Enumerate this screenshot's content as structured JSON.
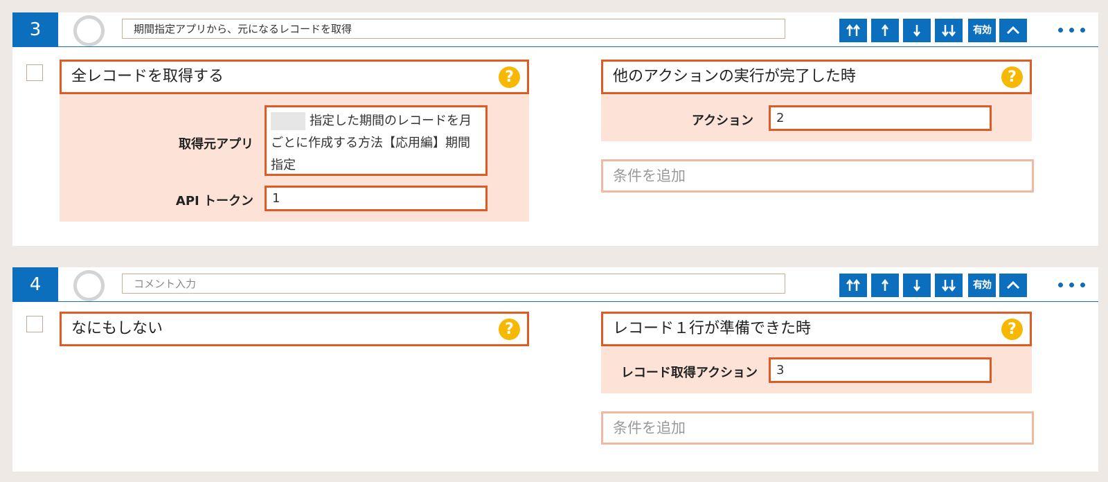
{
  "steps": [
    {
      "number": "3",
      "comment": "期間指定アプリから、元になるレコードを取得",
      "toolbar": {
        "move_top_icon": "double-up-arrow-icon",
        "move_up_icon": "up-arrow-icon",
        "move_down_icon": "down-arrow-icon",
        "move_bottom_icon": "double-down-arrow-icon",
        "enable_label": "有効",
        "collapse_icon": "chevron-up-icon",
        "more_icon": "more-dots-icon"
      },
      "action": {
        "label": "全レコードを取得する",
        "params": [
          {
            "label": "取得元アプリ",
            "value": "指定した期間のレコードを月ごとに作成する方法【応用編】期間指定"
          },
          {
            "label": "API トークン",
            "value": "1"
          }
        ]
      },
      "trigger": {
        "label": "他のアクションの実行が完了した時",
        "params": [
          {
            "label": "アクション",
            "value": "2"
          }
        ],
        "add_condition": "条件を追加"
      }
    },
    {
      "number": "4",
      "comment_placeholder": "コメント入力",
      "toolbar": {
        "enable_label": "有効"
      },
      "action": {
        "label": "なにもしない"
      },
      "trigger": {
        "label": "レコード１行が準備できた時",
        "params": [
          {
            "label": "レコード取得アクション",
            "value": "3"
          }
        ],
        "add_condition": "条件を追加"
      }
    }
  ],
  "colors": {
    "accent": "#0b6fbd",
    "highlight_border": "#e05a24",
    "panel_bg": "#fde2d8",
    "help_icon": "#f6b800",
    "page_bg": "#efe9e5"
  }
}
